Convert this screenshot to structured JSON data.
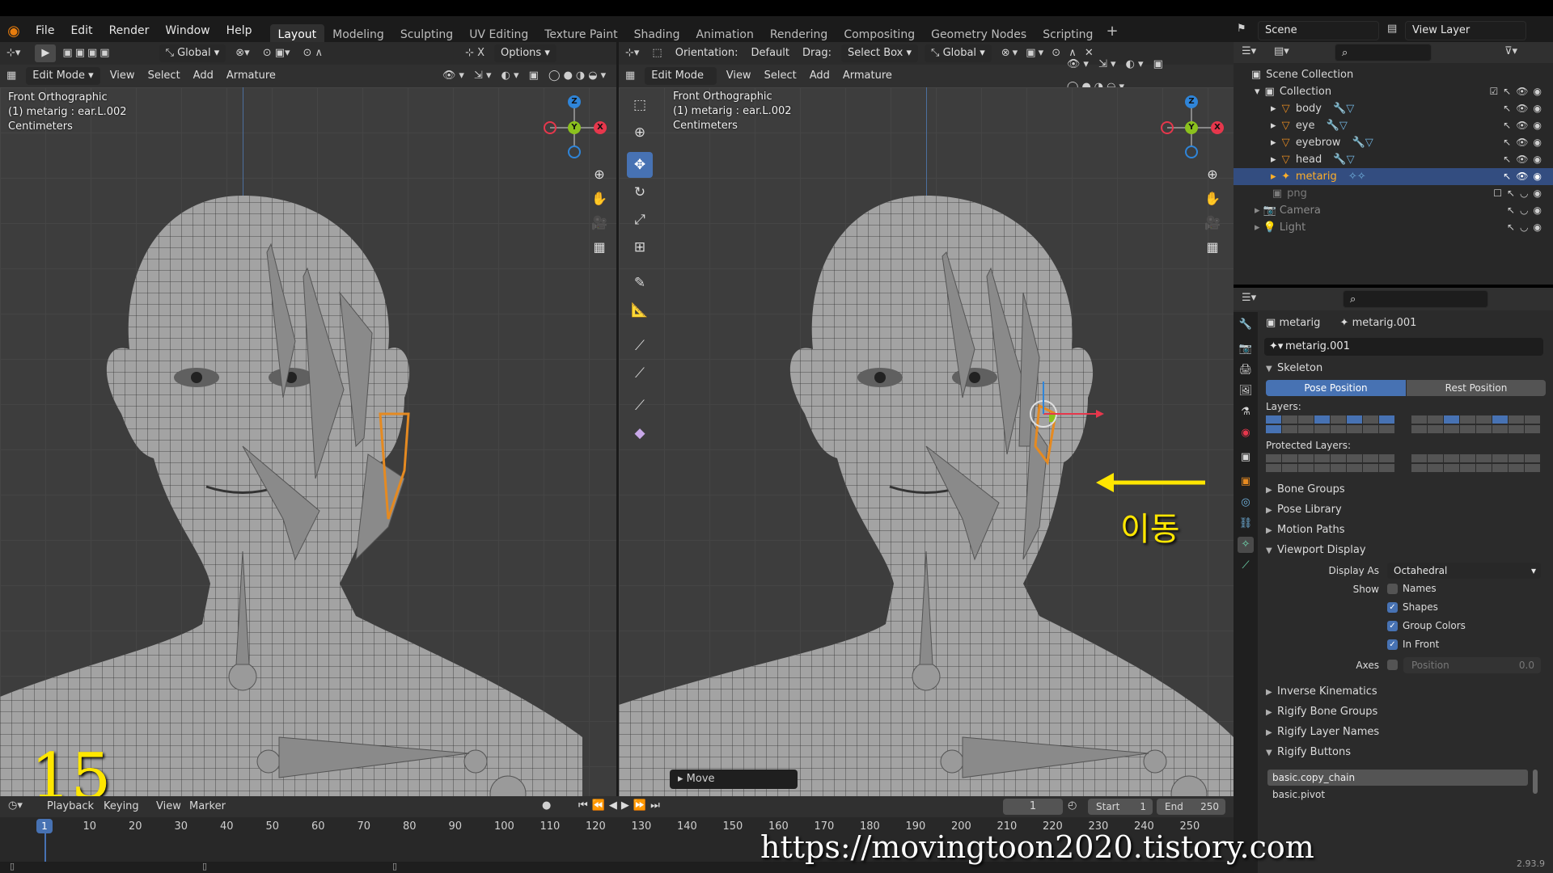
{
  "menubar": {
    "menus": [
      "File",
      "Edit",
      "Render",
      "Window",
      "Help"
    ],
    "workspaces": [
      "Layout",
      "Modeling",
      "Sculpting",
      "UV Editing",
      "Texture Paint",
      "Shading",
      "Animation",
      "Rendering",
      "Compositing",
      "Geometry Nodes",
      "Scripting"
    ],
    "active_workspace": "Layout",
    "scene": "Scene",
    "view_layer": "View Layer"
  },
  "left_viewport": {
    "transform_orientation": "Global",
    "options": "Options",
    "mode": "Edit Mode",
    "menus": [
      "View",
      "Select",
      "Add",
      "Armature"
    ],
    "info_line1": "Front Orthographic",
    "info_line2": "(1) metarig : ear.L.002",
    "info_line3": "Centimeters"
  },
  "right_viewport": {
    "orientation_label": "Orientation:",
    "orientation_value": "Default",
    "drag_label": "Drag:",
    "drag_value": "Select Box",
    "transform_orientation": "Global",
    "mode": "Edit Mode",
    "menus": [
      "View",
      "Select",
      "Add",
      "Armature"
    ],
    "info_line1": "Front Orthographic",
    "info_line2": "(1) metarig : ear.L.002",
    "info_line3": "Centimeters",
    "annotation": "이동",
    "last_op": "Move"
  },
  "outliner": {
    "root": "Scene Collection",
    "collection": "Collection",
    "items": [
      {
        "name": "body",
        "selected": false
      },
      {
        "name": "eye",
        "selected": false
      },
      {
        "name": "eyebrow",
        "selected": false
      },
      {
        "name": "head",
        "selected": false
      },
      {
        "name": "metarig",
        "selected": true
      }
    ],
    "extra": [
      "png",
      "Camera",
      "Light"
    ]
  },
  "properties": {
    "breadcrumb_object": "metarig",
    "breadcrumb_data": "metarig.001",
    "data_name": "metarig.001",
    "skeleton": "Skeleton",
    "pose_position": "Pose Position",
    "rest_position": "Rest Position",
    "layers_label": "Layers:",
    "protected_layers_label": "Protected Layers:",
    "panels_collapsed": [
      "Bone Groups",
      "Pose Library",
      "Motion Paths"
    ],
    "viewport_display": "Viewport Display",
    "display_as_label": "Display As",
    "display_as_value": "Octahedral",
    "show_label": "Show",
    "show_names": "Names",
    "show_shapes": "Shapes",
    "show_group_colors": "Group Colors",
    "show_in_front": "In Front",
    "axes_label": "Axes",
    "axes_position": "Position",
    "axes_value": "0.0",
    "more_panels": [
      "Inverse Kinematics",
      "Rigify Bone Groups",
      "Rigify Layer Names"
    ],
    "rigify_buttons": "Rigify Buttons",
    "rigify_list": [
      "basic.copy_chain",
      "basic.pivot"
    ],
    "version": "2.93.9"
  },
  "timeline": {
    "menus": [
      "Playback",
      "Keying",
      "View",
      "Marker"
    ],
    "current_frame": "1",
    "start_label": "Start",
    "start": "1",
    "end_label": "End",
    "end": "250",
    "ticks": [
      "1",
      "10",
      "20",
      "30",
      "40",
      "50",
      "60",
      "70",
      "80",
      "90",
      "100",
      "110",
      "120",
      "130",
      "140",
      "150",
      "160",
      "170",
      "180",
      "190",
      "200",
      "210",
      "220",
      "230",
      "240",
      "250"
    ]
  },
  "overlay": {
    "step_number": "15",
    "watermark": "https://movingtoon2020.tistory.com"
  },
  "colors": {
    "accent": "#4772b3",
    "selected_orange": "#ffaf29",
    "annotation_yellow": "#ffe600",
    "axis_x": "#e6374c",
    "axis_y": "#8bc11d",
    "axis_z": "#2f85d9"
  }
}
